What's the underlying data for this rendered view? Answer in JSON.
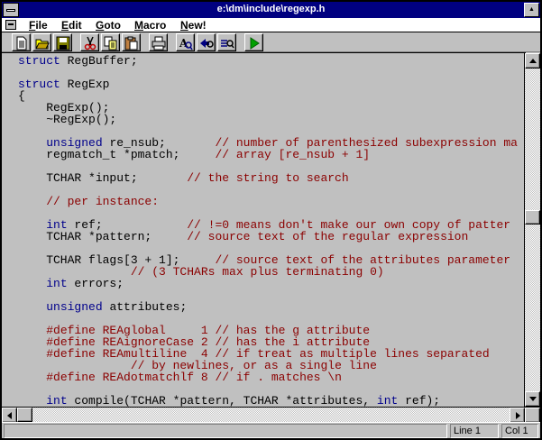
{
  "window": {
    "title": "e:\\dm\\include\\regexp.h"
  },
  "menu": {
    "items": [
      {
        "label": "File",
        "underline": "F"
      },
      {
        "label": "Edit",
        "underline": "E"
      },
      {
        "label": "Goto",
        "underline": "G"
      },
      {
        "label": "Macro",
        "underline": "M"
      },
      {
        "label": "New!",
        "underline": "N"
      }
    ]
  },
  "toolbar": {
    "buttons": [
      {
        "name": "new-file-icon"
      },
      {
        "name": "open-folder-icon"
      },
      {
        "name": "save-icon"
      },
      {
        "name": "cut-icon"
      },
      {
        "name": "copy-icon"
      },
      {
        "name": "paste-icon"
      },
      {
        "name": "print-icon"
      },
      {
        "name": "find-icon"
      },
      {
        "name": "find-next-icon"
      },
      {
        "name": "replace-icon"
      },
      {
        "name": "run-icon"
      }
    ]
  },
  "editor": {
    "lines": [
      [
        [
          "kw",
          "struct"
        ],
        [
          "tx",
          " RegBuffer;"
        ]
      ],
      [],
      [
        [
          "kw",
          "struct"
        ],
        [
          "tx",
          " RegExp"
        ]
      ],
      [
        [
          "tx",
          "{"
        ]
      ],
      [
        [
          "tx",
          "    RegExp();"
        ]
      ],
      [
        [
          "tx",
          "    ~RegExp();"
        ]
      ],
      [],
      [
        [
          "tx",
          "    "
        ],
        [
          "kw",
          "unsigned"
        ],
        [
          "tx",
          " re_nsub;       "
        ],
        [
          "cm",
          "// number of parenthesized subexpression ma"
        ]
      ],
      [
        [
          "tx",
          "    regmatch_t *pmatch;     "
        ],
        [
          "cm",
          "// array [re_nsub + 1]"
        ]
      ],
      [],
      [
        [
          "tx",
          "    TCHAR *input;       "
        ],
        [
          "cm",
          "// the string to search"
        ]
      ],
      [],
      [
        [
          "tx",
          "    "
        ],
        [
          "cm",
          "// per instance:"
        ]
      ],
      [],
      [
        [
          "tx",
          "    "
        ],
        [
          "kw",
          "int"
        ],
        [
          "tx",
          " ref;            "
        ],
        [
          "cm",
          "// !=0 means don't make our own copy of patter"
        ]
      ],
      [
        [
          "tx",
          "    TCHAR *pattern;     "
        ],
        [
          "cm",
          "// source text of the regular expression"
        ]
      ],
      [],
      [
        [
          "tx",
          "    TCHAR flags[3 + 1];     "
        ],
        [
          "cm",
          "// source text of the attributes parameter"
        ]
      ],
      [
        [
          "tx",
          "                "
        ],
        [
          "cm",
          "// (3 TCHARs max plus terminating 0)"
        ]
      ],
      [
        [
          "tx",
          "    "
        ],
        [
          "kw",
          "int"
        ],
        [
          "tx",
          " errors;"
        ]
      ],
      [],
      [
        [
          "tx",
          "    "
        ],
        [
          "kw",
          "unsigned"
        ],
        [
          "tx",
          " attributes;"
        ]
      ],
      [],
      [
        [
          "tx",
          "    "
        ],
        [
          "pp",
          "#define REAglobal     1 // has the g attribute"
        ]
      ],
      [
        [
          "tx",
          "    "
        ],
        [
          "pp",
          "#define REAignoreCase 2 // has the i attribute"
        ]
      ],
      [
        [
          "tx",
          "    "
        ],
        [
          "pp",
          "#define REAmultiline  4 // if treat as multiple lines separated"
        ]
      ],
      [
        [
          "tx",
          "                "
        ],
        [
          "pp",
          "// by newlines, or as a single line"
        ]
      ],
      [
        [
          "tx",
          "    "
        ],
        [
          "pp",
          "#define REAdotmatchlf 8 // if . matches \\n"
        ]
      ],
      [],
      [
        [
          "tx",
          "    "
        ],
        [
          "kw",
          "int"
        ],
        [
          "tx",
          " compile(TCHAR *pattern, TCHAR *attributes, "
        ],
        [
          "kw",
          "int"
        ],
        [
          "tx",
          " ref);"
        ]
      ]
    ]
  },
  "scroll": {
    "vertical_position": 0.46,
    "horizontal_position": 0.0
  },
  "status": {
    "line": "Line 1",
    "col": "Col 1"
  },
  "colors": {
    "keyword": "#00008b",
    "comment": "#8b0000",
    "titlebar": "#000080"
  }
}
